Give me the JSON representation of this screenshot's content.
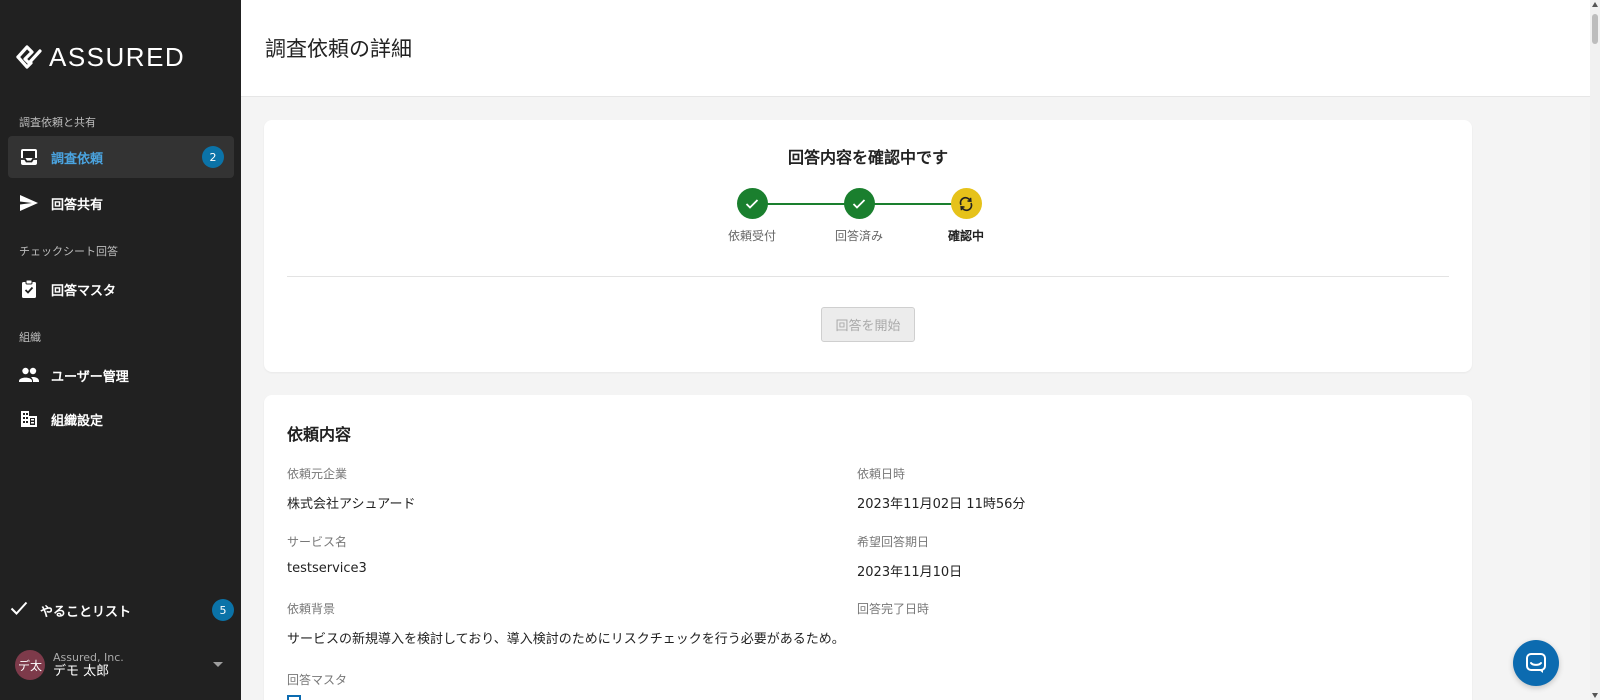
{
  "brand": {
    "name": "ASSURED"
  },
  "sidebar": {
    "sections": [
      {
        "label": "調査依頼と共有"
      },
      {
        "label": "チェックシート回答"
      },
      {
        "label": "組織"
      }
    ],
    "items": [
      {
        "label": "調査依頼",
        "badge": "2",
        "icon": "inbox-icon",
        "active": true
      },
      {
        "label": "回答共有",
        "icon": "send-icon"
      },
      {
        "label": "回答マスタ",
        "icon": "clipboard-check-icon"
      },
      {
        "label": "ユーザー管理",
        "icon": "people-icon"
      },
      {
        "label": "組織設定",
        "icon": "building-icon"
      }
    ],
    "todo": {
      "label": "やることリスト",
      "badge": "5",
      "icon": "check-icon"
    },
    "user": {
      "initials": "デ太",
      "org": "Assured, Inc.",
      "name": "デモ 太郎"
    }
  },
  "header": {
    "title": "調査依頼の詳細"
  },
  "status": {
    "title": "回答内容を確認中です",
    "steps": [
      {
        "label": "依頼受付",
        "state": "done"
      },
      {
        "label": "回答済み",
        "state": "done"
      },
      {
        "label": "確認中",
        "state": "current"
      }
    ],
    "colors": {
      "done": "#1a7f2e",
      "current": "#e6c21a"
    },
    "start_button": "回答を開始"
  },
  "detail": {
    "title": "依頼内容",
    "fields": {
      "requester": {
        "label": "依頼元企業",
        "value": "株式会社アシュアード"
      },
      "requested_at": {
        "label": "依頼日時",
        "value": "2023年11月02日 11時56分"
      },
      "service": {
        "label": "サービス名",
        "value": "testservice3"
      },
      "due_date": {
        "label": "希望回答期日",
        "value": "2023年11月10日"
      },
      "background": {
        "label": "依頼背景",
        "value": "サービスの新規導入を検討しており、導入検討のためにリスクチェックを行う必要があるため。"
      },
      "completed_at": {
        "label": "回答完了日時",
        "value": ""
      },
      "answer_master": {
        "label": "回答マスタ"
      }
    }
  },
  "colors": {
    "sidebar_bg": "#212121",
    "accent": "#0b73a8",
    "active_text": "#4aa3df"
  }
}
